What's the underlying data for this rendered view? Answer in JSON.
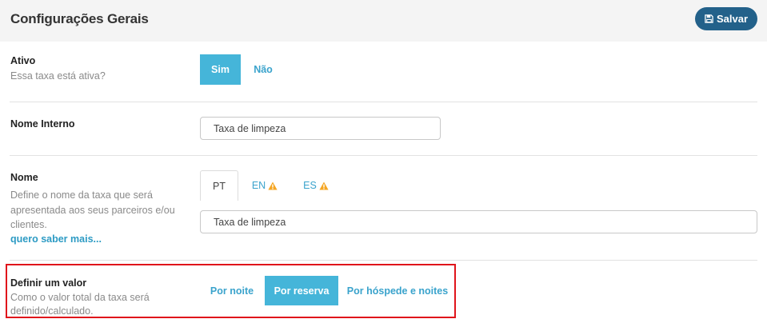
{
  "header": {
    "title": "Configurações Gerais",
    "save_label": "Salvar"
  },
  "ativo": {
    "title": "Ativo",
    "description": "Essa taxa está ativa?",
    "options": [
      "Sim",
      "Não"
    ],
    "selected": "Sim"
  },
  "nome_interno": {
    "title": "Nome Interno",
    "value": "Taxa de limpeza"
  },
  "nome": {
    "title": "Nome",
    "description_lines": [
      "Define o nome da taxa que será",
      "apresentada aos seus parceiros e/ou",
      "clientes."
    ],
    "link": "quero saber mais...",
    "tabs": [
      "PT",
      "EN",
      "ES"
    ],
    "active_tab": "PT",
    "value": "Taxa de limpeza"
  },
  "definir_valor": {
    "title": "Definir um valor",
    "description_lines": [
      "Como o valor total da taxa será",
      "definido/calculado."
    ],
    "options": [
      "Por noite",
      "Por reserva",
      "Por hóspede e noites"
    ],
    "selected": "Por reserva"
  },
  "colors": {
    "primary_dark": "#23618a",
    "accent": "#45b5d9",
    "link": "#3aa3cc",
    "warning": "#f5a623",
    "highlight": "#e0141b"
  }
}
